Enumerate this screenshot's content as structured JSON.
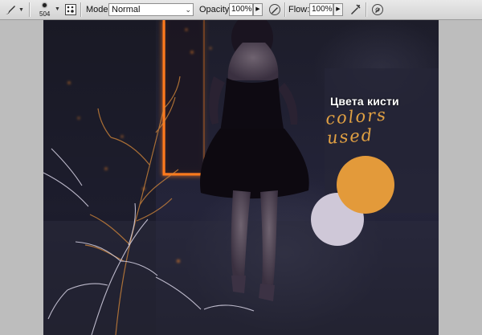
{
  "toolbar": {
    "brush_tool_icon": "brush-icon",
    "brush_size": "504",
    "brush_panel_icon": "brush-panel-icon",
    "mode_label": "Mode:",
    "mode_value": "Normal",
    "opacity_label": "Opacity:",
    "opacity_value": "100%",
    "opacity_pressure_icon": "airbrush-pressure-icon",
    "flow_label": "Flow:",
    "flow_value": "100%",
    "airbrush_icon": "airbrush-icon",
    "tablet_pressure_icon": "pressure-icon"
  },
  "canvas": {
    "caption_ru": "Цвета кисти",
    "caption_en": "colors used"
  },
  "colors": {
    "swatch_orange": "#E39A3A",
    "swatch_lavender": "#CFC8D8",
    "glow_orange": "#FF7A1A"
  }
}
